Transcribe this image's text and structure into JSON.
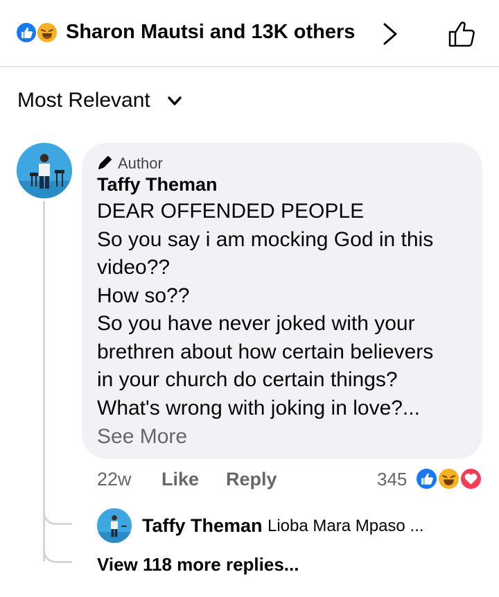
{
  "reactions_bar": {
    "summary_text": "Sharon Mautsi and 13K others",
    "icons": [
      "like-icon",
      "haha-icon"
    ],
    "colors": {
      "like": "#1877f2",
      "haha": "#f7b125"
    }
  },
  "sort": {
    "label": "Most Relevant"
  },
  "comment": {
    "badge_label": "Author",
    "author": "Taffy Theman",
    "lines": [
      "DEAR OFFENDED PEOPLE",
      "So you say i am mocking God in this",
      "video??",
      "How so??",
      "So you have never joked with your",
      "brethren about how certain believers",
      "in your church do certain things?",
      "What's wrong with joking in love?..."
    ],
    "see_more": "See More",
    "time": "22w",
    "like_label": "Like",
    "reply_label": "Reply",
    "reaction_count": "345",
    "reaction_icons": [
      "like-icon",
      "haha-icon",
      "love-icon"
    ],
    "reaction_colors": {
      "like": "#1877f2",
      "haha": "#f7b125",
      "love": "#f33e58"
    }
  },
  "reply_preview": {
    "author": "Taffy Theman",
    "snippet": "Lioba Mara Mpaso ..."
  },
  "view_more_replies": "View 118 more replies..."
}
